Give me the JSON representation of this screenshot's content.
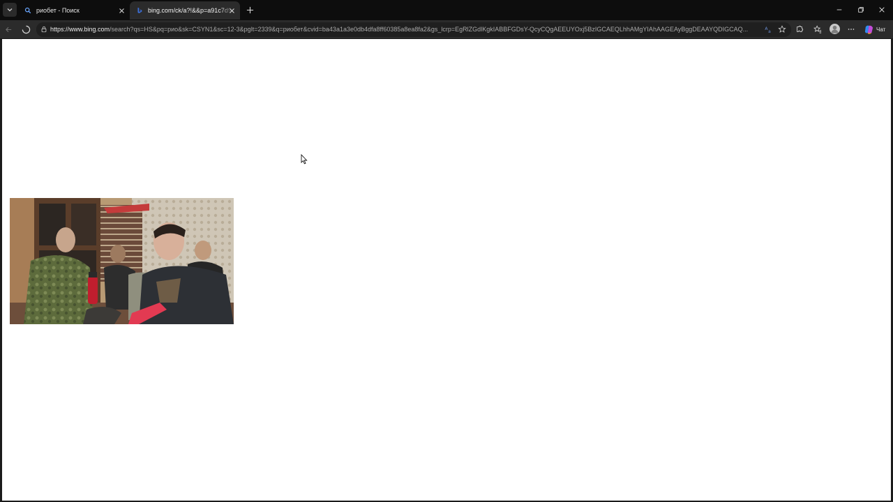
{
  "tabs": [
    {
      "title": "риобет - Поиск",
      "active": false,
      "favicon": "search-icon"
    },
    {
      "title": "bing.com/ck/a?!&&p=a91c7d9cc3",
      "active": true,
      "favicon": "bing-icon"
    }
  ],
  "address_bar": {
    "url_domain": "https://www.bing.com",
    "url_path": "/search?qs=HS&pq=рио&sk=CSYN1&sc=12-3&pglt=2339&q=риобет&cvid=ba43a1a3e0db4dfa8ff60385a8ea8fa2&gs_lcrp=EgRlZGdlKgkIABBFGDsY-QcyCQgAEEUYOxj5BzIGCAEQLhhAMgYIAhAAGEAyBggDEAAYQDIGCAQ..."
  },
  "copilot": {
    "label": "Чат"
  },
  "icons": {
    "back": "back-arrow-icon",
    "refresh": "loading-stop-icon",
    "translate": "translate-icon",
    "favorite": "star-icon",
    "extensions": "extensions-icon",
    "favorites_bar": "favorites-icon",
    "profile": "profile-icon",
    "more": "more-icon"
  },
  "colors": {
    "titlebar": "#0d0d0d",
    "toolbar": "#2b2b2b",
    "omnibox": "#1f1f1f",
    "page": "#ffffff"
  }
}
